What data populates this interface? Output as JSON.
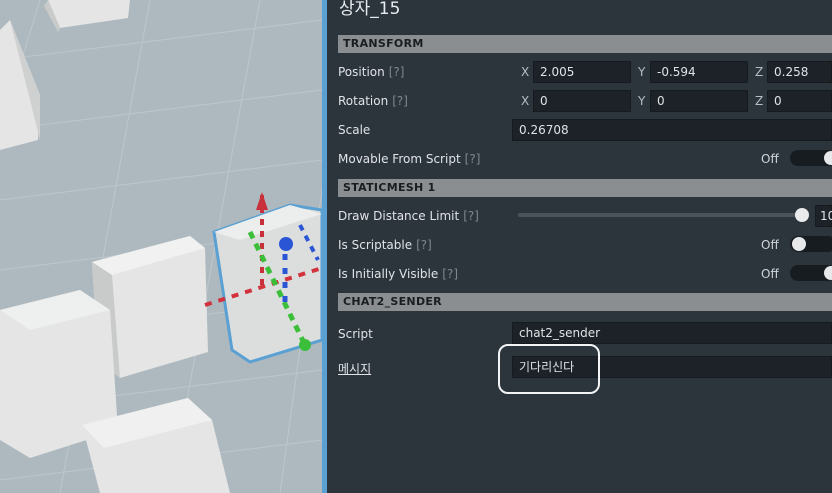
{
  "viewport": {
    "colors": {
      "floor": "#aeb9bf",
      "cube": "#e4e5e4",
      "cube_shade": "#c9cbca",
      "selected": "#5aa0d2"
    }
  },
  "inspector": {
    "object_title": "상자_15",
    "transform": {
      "header": "TRANSFORM",
      "position": {
        "label": "Position",
        "hint": "[?]",
        "x_label": "X",
        "x": "2.005",
        "y_label": "Y",
        "y": "-0.594",
        "z_label": "Z",
        "z": "0.258"
      },
      "rotation": {
        "label": "Rotation",
        "hint": "[?]",
        "x_label": "X",
        "x": "0",
        "y_label": "Y",
        "y": "0",
        "z_label": "Z",
        "z": "0"
      },
      "scale": {
        "label": "Scale",
        "value": "0.26708"
      },
      "movable": {
        "label": "Movable From Script",
        "hint": "[?]",
        "state": "Off"
      }
    },
    "staticmesh": {
      "header": "STATICMESH 1",
      "draw_distance": {
        "label": "Draw Distance Limit",
        "hint": "[?]",
        "value_text": "10"
      },
      "is_scriptable": {
        "label": "Is Scriptable",
        "hint": "[?]",
        "state": "Off"
      },
      "is_visible": {
        "label": "Is Initially Visible",
        "hint": "[?]",
        "state": "Off"
      }
    },
    "chat_sender": {
      "header": "CHAT2_SENDER",
      "script": {
        "label": "Script",
        "value": "chat2_sender"
      },
      "message": {
        "label": "메시지",
        "value": "기다리신다"
      }
    }
  }
}
